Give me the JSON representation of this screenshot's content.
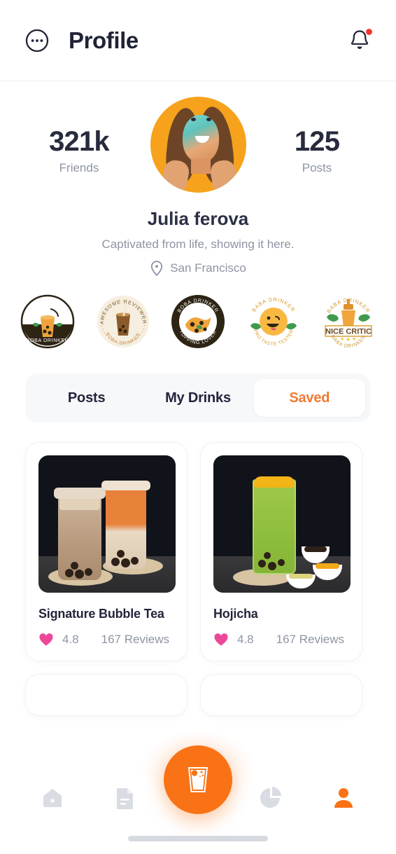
{
  "header": {
    "menu_icon": "more-horizontal-circle-icon",
    "title": "Profile",
    "bell_icon": "bell-icon",
    "has_notification": true
  },
  "profile": {
    "stats": [
      {
        "value": "321k",
        "label": "Friends"
      },
      {
        "value": "125",
        "label": "Posts"
      }
    ],
    "avatar_alt": "avatar",
    "name": "Julia ferova",
    "bio": "Captivated from life, showing it here.",
    "location_icon": "location-pin-icon",
    "location": "San Francisco"
  },
  "badges": [
    {
      "name": "boba-drinker-badge",
      "title": "BOBA DRINKER",
      "subtitle": ""
    },
    {
      "name": "awesome-reviewer-badge",
      "title": "AWESOME REVIEWER",
      "subtitle": "BOBA DRINKER"
    },
    {
      "name": "topping-lover-badge",
      "title": "BOBA DRINKER",
      "subtitle": "TOPPING LOVER"
    },
    {
      "name": "pro-taste-tester-badge",
      "title": "BABA DRINKER",
      "subtitle": "PRO TASTE TESTER"
    },
    {
      "name": "nice-critic-badge",
      "title": "BABA DRINKER",
      "subtitle": "NICE CRITIC"
    }
  ],
  "tabs": [
    {
      "label": "Posts",
      "active": false
    },
    {
      "label": "My Drinks",
      "active": false
    },
    {
      "label": "Saved",
      "active": true
    }
  ],
  "cards": [
    {
      "title": "Signature Bubble Tea",
      "heart_icon": "heart-icon",
      "rating": "4.8",
      "reviews": "167 Reviews",
      "image_alt": "two-bubble-tea-cups"
    },
    {
      "title": "Hojicha",
      "heart_icon": "heart-icon",
      "rating": "4.8",
      "reviews": "167 Reviews",
      "image_alt": "matcha-drink-with-toppings"
    }
  ],
  "bottom_nav": [
    {
      "name": "nav-home",
      "icon": "home-icon",
      "active": false
    },
    {
      "name": "nav-documents",
      "icon": "document-icon",
      "active": false
    },
    {
      "name": "nav-add-drink",
      "icon": "boba-cup-icon",
      "active": true,
      "is_fab": true
    },
    {
      "name": "nav-stats",
      "icon": "pie-chart-icon",
      "active": false
    },
    {
      "name": "nav-profile",
      "icon": "user-icon",
      "active": true
    }
  ],
  "colors": {
    "accent": "#f97316",
    "accent_text": "#f07a35",
    "heart": "#ec4899",
    "title": "#1f2335",
    "muted": "#8d94a3",
    "avatar_bg": "#f6a21c",
    "notification": "#f4362f"
  }
}
